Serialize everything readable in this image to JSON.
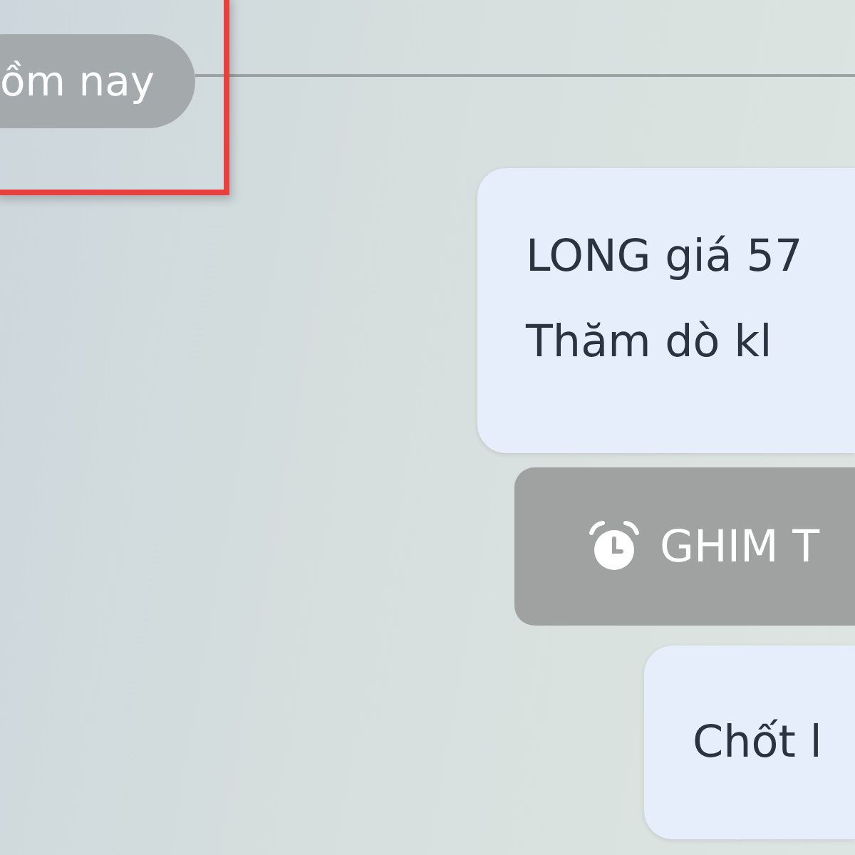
{
  "date_chip": "ồm nay",
  "messages": [
    {
      "kind": "bubble",
      "lines": [
        "LONG giá 57",
        "Thăm dò kl"
      ]
    },
    {
      "kind": "pin",
      "label": "GHIM T"
    },
    {
      "kind": "bubble",
      "lines": [
        "Chốt l"
      ]
    }
  ]
}
